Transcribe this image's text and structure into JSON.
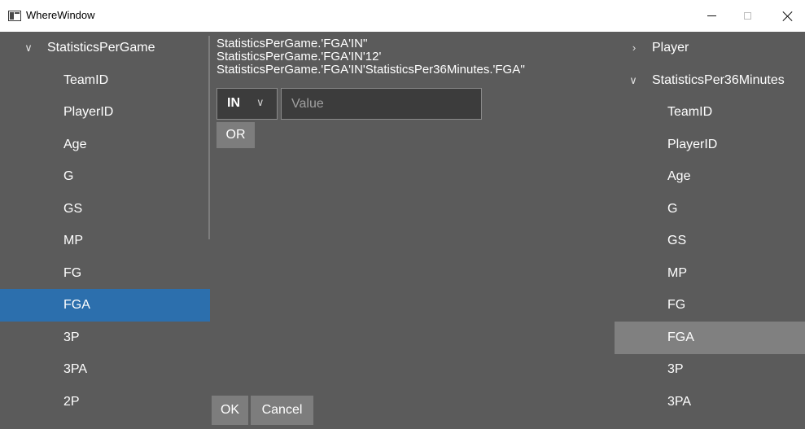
{
  "window": {
    "title": "WhereWindow",
    "minimize_icon": "minimize-icon",
    "maximize_icon": "maximize-icon",
    "close_icon": "close-icon"
  },
  "left_tree": {
    "group": "StatisticsPerGame",
    "expanded": true,
    "items": [
      "TeamID",
      "PlayerID",
      "Age",
      "G",
      "GS",
      "MP",
      "FG",
      "FGA",
      "3P",
      "3PA",
      "2P"
    ],
    "selected": "FGA",
    "selected_color": "#2c6fad"
  },
  "right_tree": {
    "groups": [
      {
        "label": "Player",
        "expanded": false
      },
      {
        "label": "StatisticsPer36Minutes",
        "expanded": true
      }
    ],
    "items": [
      "TeamID",
      "PlayerID",
      "Age",
      "G",
      "GS",
      "MP",
      "FG",
      "FGA",
      "3P",
      "3PA"
    ],
    "selected": "FGA",
    "selected_color": "#808080"
  },
  "editor": {
    "expressions": [
      "StatisticsPerGame.'FGA'IN''",
      "StatisticsPerGame.'FGA'IN'12'",
      "StatisticsPerGame.'FGA'IN'StatisticsPer36Minutes.'FGA''"
    ],
    "operator": "IN",
    "value_placeholder": "Value",
    "or_label": "OR"
  },
  "footer": {
    "ok_label": "OK",
    "cancel_label": "Cancel"
  },
  "colors": {
    "background": "#5b5b5b",
    "titlebar": "#ffffff"
  }
}
